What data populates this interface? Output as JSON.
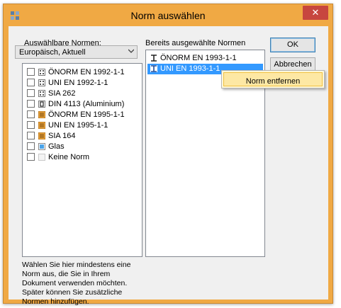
{
  "window": {
    "title": "Norm auswählen",
    "close_label": "✕"
  },
  "available": {
    "label": "Auswählbare Normen:",
    "filter_value": "Europäisch, Aktuell",
    "items": [
      {
        "label": "ÖNORM EN 1992-1-1",
        "icon": "concrete-icon",
        "checked": false
      },
      {
        "label": "UNI EN 1992-1-1",
        "icon": "concrete-icon",
        "checked": false
      },
      {
        "label": "SIA 262",
        "icon": "concrete-icon",
        "checked": false
      },
      {
        "label": "DIN 4113 (Aluminium)",
        "icon": "aluminium-icon",
        "checked": false
      },
      {
        "label": "ÖNORM EN 1995-1-1",
        "icon": "timber-icon",
        "checked": false
      },
      {
        "label": "UNI EN 1995-1-1",
        "icon": "timber-icon",
        "checked": false
      },
      {
        "label": "SIA 164",
        "icon": "timber-icon",
        "checked": false
      },
      {
        "label": "Glas",
        "icon": "glass-icon",
        "checked": false
      },
      {
        "label": "Keine Norm",
        "icon": "none-icon",
        "checked": false
      }
    ]
  },
  "selected": {
    "label": "Bereits ausgewählte Normen",
    "items": [
      {
        "label": "ÖNORM EN 1993-1-1",
        "icon": "steel-icon"
      },
      {
        "label": "UNI EN 1993-1-1",
        "icon": "steel-icon",
        "highlighted": true
      }
    ]
  },
  "buttons": {
    "ok": "OK",
    "cancel": "Abbrechen"
  },
  "context_menu": {
    "remove": "Norm entfernen"
  },
  "hint": "Wählen Sie hier mindestens eine Norm aus, die Sie in Ihrem Dokument verwenden möchten. Später können Sie zusätzliche Normen hinzufügen."
}
